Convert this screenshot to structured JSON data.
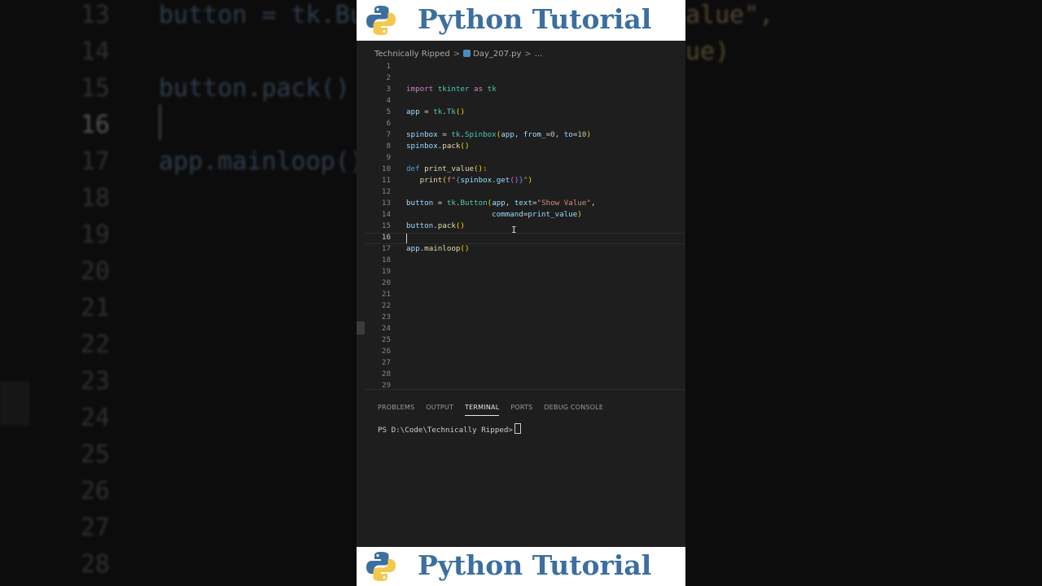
{
  "banner": {
    "title": "Python Tutorial",
    "logo_icon": "python-logo-icon",
    "title_color": "#3c6f9e"
  },
  "background": {
    "lines": [
      {
        "num": "13",
        "code": "button = tk.Bu",
        "tail": "alue\","
      },
      {
        "num": "14",
        "code": "",
        "tail": "ue)"
      },
      {
        "num": "15",
        "code": "button.pack()",
        "tail": ""
      },
      {
        "num": "16",
        "code": "",
        "tail": ""
      },
      {
        "num": "17",
        "code": "app.mainloop()",
        "tail": ""
      },
      {
        "num": "18",
        "code": "",
        "tail": ""
      },
      {
        "num": "19",
        "code": "",
        "tail": ""
      },
      {
        "num": "20",
        "code": "",
        "tail": ""
      },
      {
        "num": "21",
        "code": "",
        "tail": ""
      },
      {
        "num": "22",
        "code": "",
        "tail": ""
      },
      {
        "num": "23",
        "code": "",
        "tail": ""
      },
      {
        "num": "24",
        "code": "",
        "tail": ""
      },
      {
        "num": "25",
        "code": "",
        "tail": ""
      },
      {
        "num": "26",
        "code": "",
        "tail": ""
      },
      {
        "num": "27",
        "code": "",
        "tail": ""
      },
      {
        "num": "28",
        "code": "",
        "tail": ""
      }
    ]
  },
  "editor": {
    "breadcrumb": {
      "folder": "Technically Ripped",
      "file": "Day_207.py",
      "more": "..."
    },
    "current_line": 16,
    "line_numbers": [
      "1",
      "2",
      "3",
      "4",
      "5",
      "6",
      "7",
      "8",
      "9",
      "10",
      "11",
      "12",
      "13",
      "14",
      "15",
      "16",
      "17",
      "18",
      "19",
      "20",
      "21",
      "22",
      "23",
      "24",
      "25",
      "26",
      "27",
      "28",
      "29"
    ],
    "code": {
      "l3": {
        "kw": "import",
        "mod": "tkinter",
        "as": "as",
        "alias": "tk"
      },
      "l5": {
        "var": "app",
        "eq": " = ",
        "mod": "tk",
        "cls": "Tk",
        "par": "()"
      },
      "l7": {
        "var": "spinbox",
        "eq": " = ",
        "mod": "tk",
        "cls": "Spinbox",
        "args1": "app, ",
        "k1": "from_",
        "v1": "0",
        "sep": ", ",
        "k2": "to",
        "v2": "10"
      },
      "l8": {
        "var": "spinbox",
        "fn": "pack",
        "par": "()"
      },
      "l10": {
        "kw": "def",
        "fn": "print_value",
        "par": "():"
      },
      "l11": {
        "fn": "print",
        "fpre": "f\"",
        "inner": "spinbox.get",
        "post": "\""
      },
      "l13": {
        "var": "button",
        "eq": " = ",
        "mod": "tk",
        "cls": "Button",
        "args1": "app, ",
        "k1": "text",
        "v1": "\"Show Value\"",
        "end": ","
      },
      "l14": {
        "k": "command",
        "v": "print_value"
      },
      "l15": {
        "var": "button",
        "fn": "pack",
        "par": "()"
      },
      "l17": {
        "var": "app",
        "fn": "mainloop",
        "par": "()"
      }
    }
  },
  "panel": {
    "tabs": [
      "PROBLEMS",
      "OUTPUT",
      "TERMINAL",
      "PORTS",
      "DEBUG CONSOLE"
    ],
    "active_tab": "TERMINAL",
    "prompt": "PS D:\\Code\\Technically Ripped>"
  }
}
